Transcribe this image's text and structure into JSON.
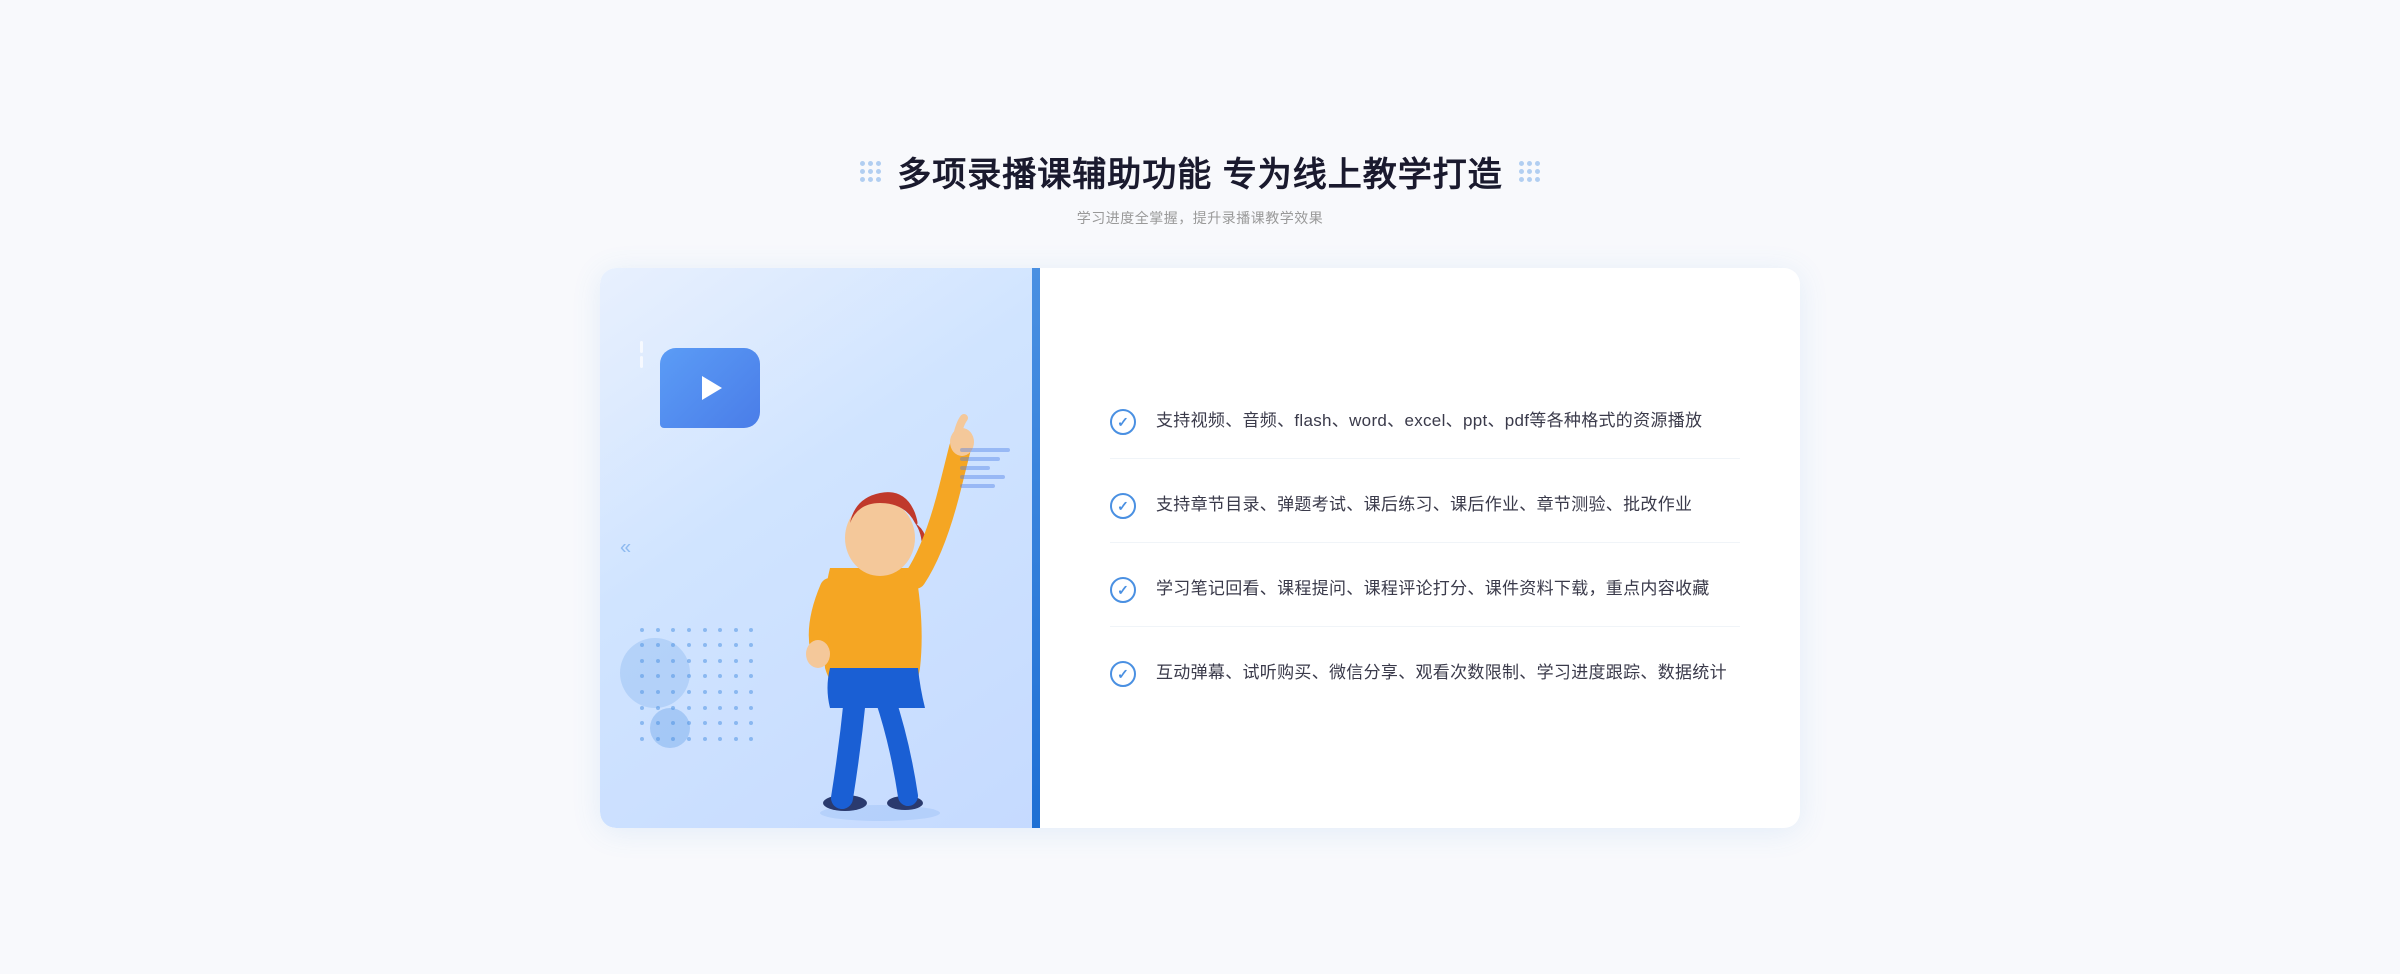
{
  "header": {
    "title": "多项录播课辅助功能 专为线上教学打造",
    "subtitle": "学习进度全掌握，提升录播课教学效果"
  },
  "features": [
    {
      "id": 1,
      "text": "支持视频、音频、flash、word、excel、ppt、pdf等各种格式的资源播放"
    },
    {
      "id": 2,
      "text": "支持章节目录、弹题考试、课后练习、课后作业、章节测验、批改作业"
    },
    {
      "id": 3,
      "text": "学习笔记回看、课程提问、课程评论打分、课件资料下载，重点内容收藏"
    },
    {
      "id": 4,
      "text": "互动弹幕、试听购买、微信分享、观看次数限制、学习进度跟踪、数据统计"
    }
  ]
}
